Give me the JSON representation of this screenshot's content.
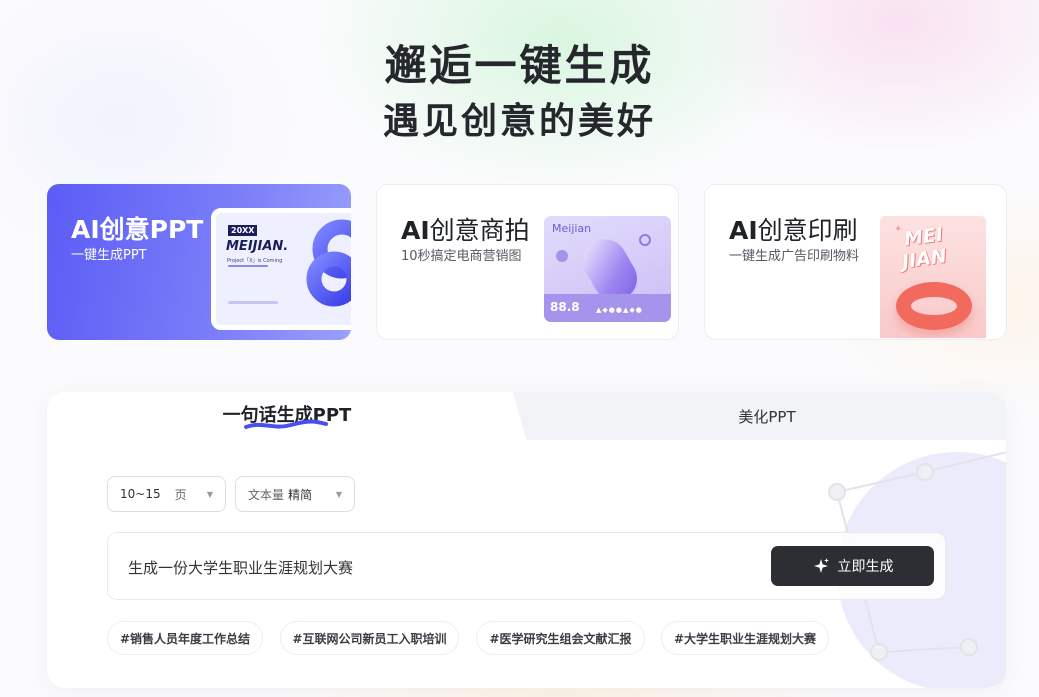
{
  "headline": {
    "line1": "邂逅一键生成",
    "line2": "遇见创意的美好"
  },
  "feature_cards": [
    {
      "prefix": "AI",
      "name": "创意PPT",
      "subtitle": "一键生成PPT",
      "active": true,
      "art": {
        "year": "20XX",
        "brand": "MEIJIAN.",
        "caption": "Project「X」is Coming"
      }
    },
    {
      "prefix": "AI",
      "name": "创意商拍",
      "subtitle": "10秒搞定电商营销图",
      "active": false,
      "art": {
        "brand": "Meijian",
        "price": "88.8"
      }
    },
    {
      "prefix": "AI",
      "name": "创意印刷",
      "subtitle": "一键生成广告印刷物料",
      "active": false,
      "art": {
        "brand_line1": "MEI",
        "brand_line2": "JIAN"
      }
    }
  ],
  "tabs": [
    {
      "label": "一句话生成PPT",
      "active": true
    },
    {
      "label": "美化PPT",
      "active": false
    }
  ],
  "options": {
    "pages": {
      "value": "10~15",
      "unit": "页"
    },
    "text_amount": {
      "label": "文本量",
      "value": "精简"
    }
  },
  "prompt": {
    "value": "生成一份大学生职业生涯规划大赛",
    "button_label": "立即生成",
    "button_icon": "sparkle-icon"
  },
  "suggestions": [
    "#销售人员年度工作总结",
    "#互联网公司新员工入职培训",
    "#医学研究生组会文献汇报",
    "#大学生职业生涯规划大赛"
  ],
  "colors": {
    "accent": "#5b5cf6",
    "button_dark": "#2c2e33",
    "underline": "#4b4ff0"
  }
}
